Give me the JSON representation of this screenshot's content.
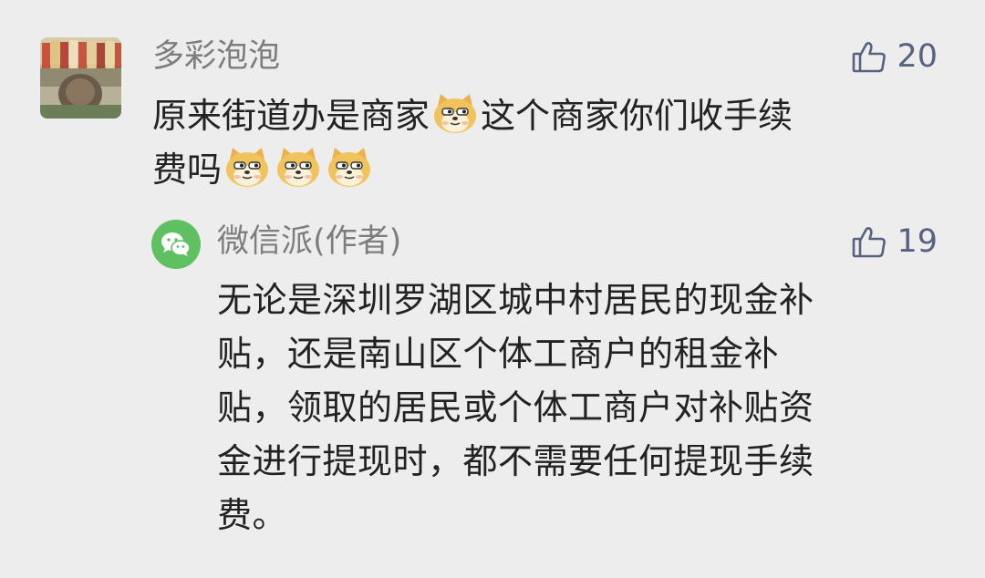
{
  "comment": {
    "author": "多彩泡泡",
    "likes": "20",
    "text_lines": [
      [
        "原来街道办是商家",
        "doge-emoji",
        "这个商家你们收手续"
      ],
      [
        "费吗",
        "doge-emoji",
        "doge-emoji",
        "doge-emoji"
      ]
    ],
    "line1_a": "原来街道办是商家",
    "line1_b": "这个商家你们收手续",
    "line2_a": "费吗"
  },
  "reply": {
    "author": "微信派(作者)",
    "likes": "19",
    "lines": [
      "无论是深圳罗湖区城中村居民的现金补",
      "贴，还是南山区个体工商户的租金补",
      "贴，领取的居民或个体工商户对补贴资",
      "金进行提现时，都不需要任何提现手续",
      "费。"
    ]
  },
  "icons": {
    "like": "thumbs-up-icon",
    "emoji": "doge-emoji",
    "reply_avatar": "wechat-logo-icon"
  },
  "colors": {
    "background": "#ededed",
    "name": "#7d7d7d",
    "like": "#56627e",
    "text": "#222222",
    "wechat_green": "#5fc062"
  }
}
